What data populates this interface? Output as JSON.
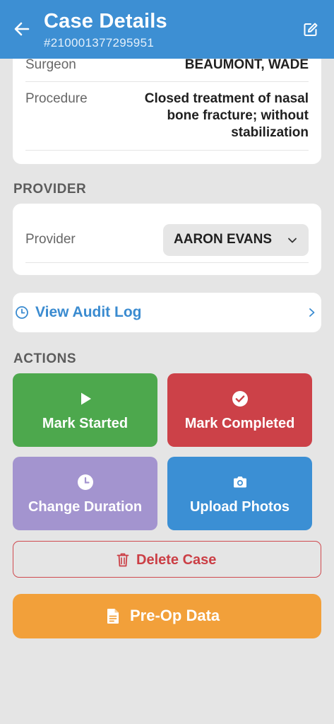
{
  "header": {
    "title": "Case Details",
    "case_number": "#210001377295951",
    "back_icon": "arrow-left-icon",
    "edit_icon": "edit-icon"
  },
  "details": {
    "surgeon_label": "Surgeon",
    "surgeon_value": "BEAUMONT, WADE",
    "procedure_label": "Procedure",
    "procedure_value_lines": [
      "Closed treatment of nasal",
      "bone fracture; without",
      "stabilization"
    ]
  },
  "provider_section": {
    "title": "PROVIDER",
    "label": "Provider",
    "selected": "AARON EVANS"
  },
  "audit": {
    "label": "View Audit Log",
    "icon": "clock-icon"
  },
  "actions": {
    "title": "ACTIONS",
    "mark_started": "Mark Started",
    "mark_completed": "Mark Completed",
    "change_duration": "Change Duration",
    "upload_photos": "Upload Photos",
    "delete_case": "Delete Case",
    "pre_op_data": "Pre-Op Data"
  },
  "colors": {
    "header": "#3d8fd3",
    "green": "#4da84d",
    "red": "#cc4148",
    "purple": "#a394cf",
    "blue": "#3b8fd4",
    "orange": "#f2a03a"
  }
}
